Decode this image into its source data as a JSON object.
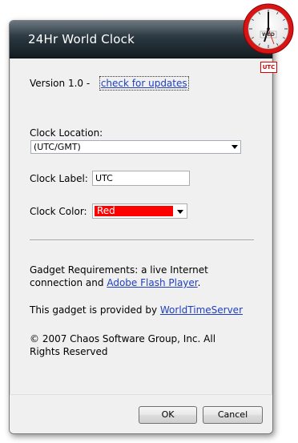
{
  "window": {
    "title": "24Hr World Clock"
  },
  "version": {
    "text": "Version 1.0 -",
    "update_link": "check for updates"
  },
  "location": {
    "label": "Clock Location:",
    "value": "(UTC/GMT)"
  },
  "clock_label": {
    "label": "Clock Label:",
    "value": "UTC"
  },
  "clock_color": {
    "label": "Clock Color:",
    "value": "Red",
    "color": "#ff0000"
  },
  "requirements": {
    "text": "Gadget Requirements: a live Internet connection and",
    "link": "Adobe Flash Player",
    "suffix": "."
  },
  "provider": {
    "text": "This gadget is provided by",
    "link": "WorldTimeServer"
  },
  "copyright": {
    "text": "© 2007 Chaos Software Group, Inc. All Rights Reserved"
  },
  "buttons": {
    "ok": "OK",
    "cancel": "Cancel"
  },
  "gadget": {
    "day": "WED",
    "badge": "UTC",
    "accent": "#e01010"
  }
}
